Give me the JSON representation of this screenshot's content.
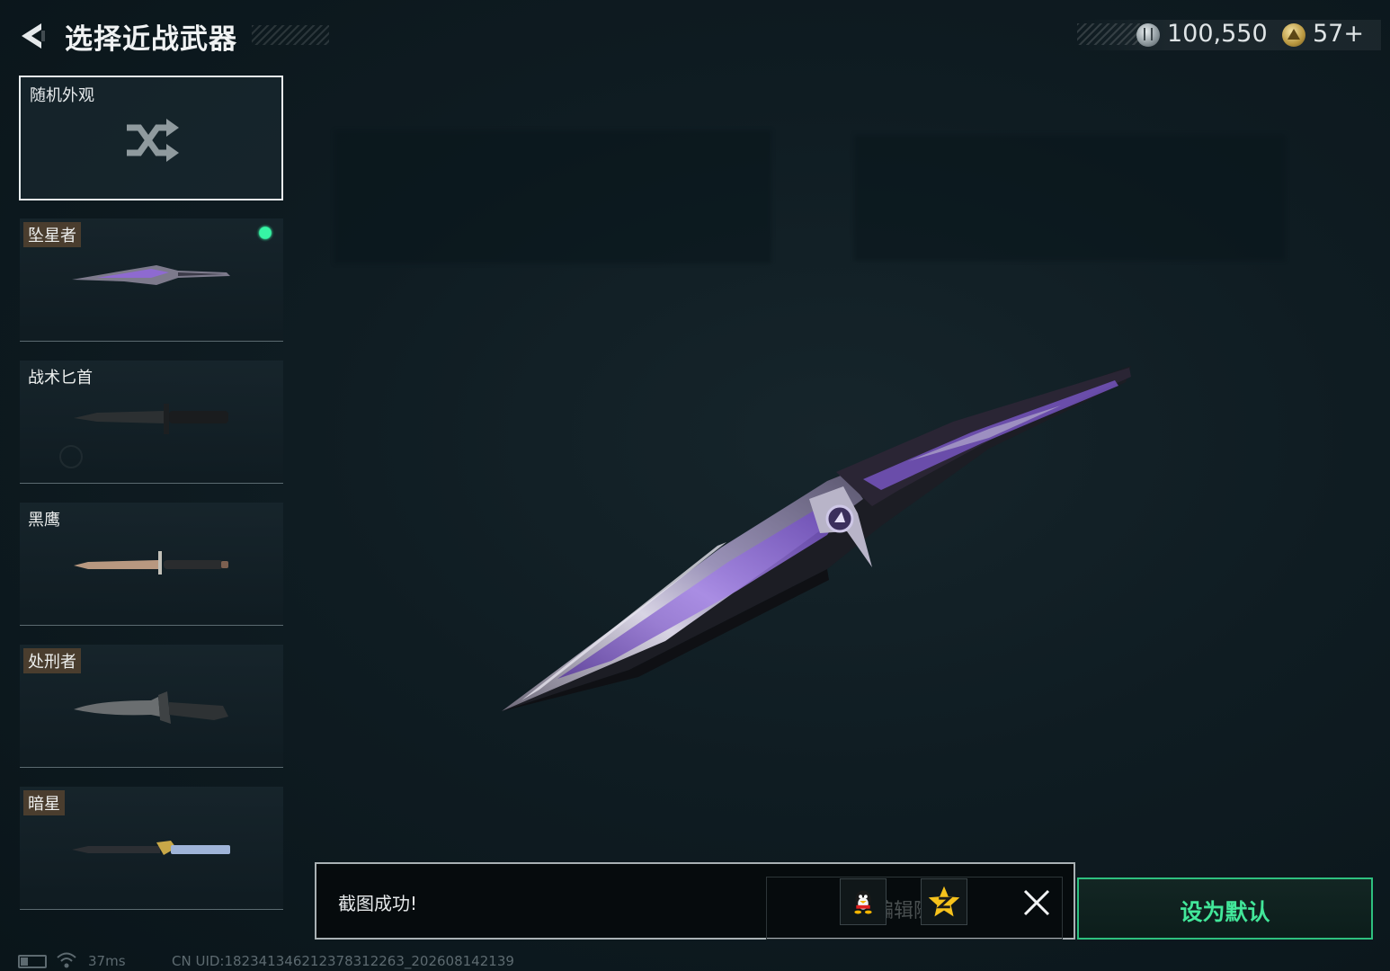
{
  "header": {
    "title": "选择近战武器",
    "back_icon": "back-arrow-icon"
  },
  "currency": {
    "silver_icon": "silver-coin-icon",
    "silver_value": "100,550",
    "gold_icon": "gold-coin-icon",
    "gold_value": "57+"
  },
  "random_card": {
    "label": "随机外观",
    "icon": "shuffle-icon"
  },
  "weapons": [
    {
      "name": "坠星者",
      "tagged": true,
      "equipped": true,
      "icon": "falling-star-knife-icon"
    },
    {
      "name": "战术匕首",
      "tagged": false,
      "equipped": false,
      "icon": "tactical-dagger-icon"
    },
    {
      "name": "黑鹰",
      "tagged": false,
      "equipped": false,
      "icon": "black-eagle-knife-icon"
    },
    {
      "name": "处刑者",
      "tagged": true,
      "equipped": false,
      "icon": "executioner-knife-icon"
    },
    {
      "name": "暗星",
      "tagged": true,
      "equipped": false,
      "icon": "dark-star-knife-icon"
    }
  ],
  "toast": {
    "message": "截图成功!",
    "edit_random_label": "编辑随机",
    "share_qq_icon": "qq-penguin-icon",
    "share_qzone_icon": "qzone-star-icon",
    "close_icon": "close-icon"
  },
  "set_default_label": "设为默认",
  "status": {
    "ping": "37ms",
    "uid": "CN UID:182341346212378312263_202608142139",
    "battery_level": 0.3
  },
  "colors": {
    "accent_green": "#42e79a",
    "equipped_dot": "#36f5a4",
    "name_tag_bg": "#4a3d2e",
    "knife_purple": "#8a5cd6"
  }
}
